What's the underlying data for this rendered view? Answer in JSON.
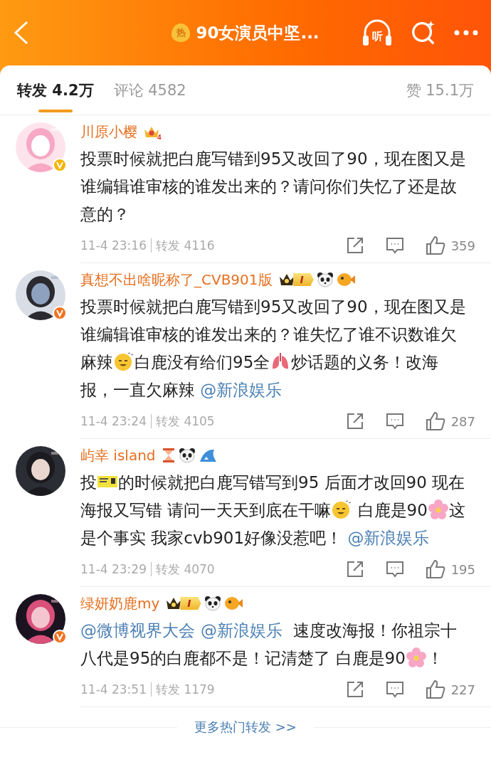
{
  "header": {
    "hot_label": "热",
    "title": "90女演员中坚...",
    "listen_label": "听"
  },
  "tabs": [
    {
      "label": "转发 4.2万",
      "selected": true
    },
    {
      "label": "评论 4582",
      "selected": false
    },
    {
      "label": "赞 15.1万",
      "selected": false
    }
  ],
  "posts": [
    {
      "name": "川原小樱",
      "verified": {
        "color": "#f5b400"
      },
      "badges": [
        {
          "kind": "crown",
          "text": "4"
        }
      ],
      "body": [
        {
          "kind": "text",
          "text": "投票时候就把白鹿写错到95又改回了90，现在图又是谁编辑谁审核的谁发出来的？请问你们失忆了还是故意的？"
        }
      ],
      "time": "11-4 23:16",
      "reposts": "转发 4116",
      "likes": "359"
    },
    {
      "name": "真想不出啥昵称了_CVB901版",
      "verified": {
        "color": "#f1731f"
      },
      "badges": [
        {
          "kind": "vip",
          "text": "I"
        },
        {
          "kind": "panda"
        },
        {
          "kind": "fish"
        }
      ],
      "body": [
        {
          "kind": "text",
          "text": "投票时候就把白鹿写错到95又改回了90，现在图又是谁编辑谁审核的谁发出来的？谁失忆了谁不识数谁欠麻辣"
        },
        {
          "kind": "dizzy"
        },
        {
          "kind": "text",
          "text": "白鹿没有给们95全"
        },
        {
          "kind": "lungs"
        },
        {
          "kind": "text",
          "text": "炒话题的义务！改海报，一直欠麻辣 "
        },
        {
          "kind": "mention",
          "text": "@新浪娱乐"
        }
      ],
      "time": "11-4 23:24",
      "reposts": "转发 4105",
      "likes": "287"
    },
    {
      "name": "屿幸 island",
      "badges": [
        {
          "kind": "hourglass"
        },
        {
          "kind": "panda"
        },
        {
          "kind": "shark"
        }
      ],
      "body": [
        {
          "kind": "text",
          "text": "投"
        },
        {
          "kind": "ticket"
        },
        {
          "kind": "text",
          "text": "的时候就把白鹿写错写到95 后面才改回90 现在海报又写错 请问一天天到底在干嘛"
        },
        {
          "kind": "dizzy"
        },
        {
          "kind": "text",
          "text": " 白鹿是90"
        },
        {
          "kind": "flower"
        },
        {
          "kind": "text",
          "text": "这是个事实 我家cvb901好像没惹吧！ "
        },
        {
          "kind": "mention",
          "text": "@新浪娱乐"
        }
      ],
      "time": "11-4 23:29",
      "reposts": "转发 4070",
      "likes": "195"
    },
    {
      "name": "绿妍奶鹿my",
      "verified": {
        "color": "#f1731f"
      },
      "badges": [
        {
          "kind": "vip",
          "text": "I"
        },
        {
          "kind": "panda"
        },
        {
          "kind": "fish"
        }
      ],
      "body": [
        {
          "kind": "mention",
          "text": "@微博视界大会"
        },
        {
          "kind": "mention",
          "text": "@新浪娱乐"
        },
        {
          "kind": "text",
          "text": " 速度改海报！你祖宗十八代是95的白鹿都不是！记清楚了 白鹿是90"
        },
        {
          "kind": "flower"
        },
        {
          "kind": "text",
          "text": "！"
        }
      ],
      "time": "11-4 23:51",
      "reposts": "转发 1179",
      "likes": "227"
    }
  ],
  "more_link": "更多热门转发 >>"
}
